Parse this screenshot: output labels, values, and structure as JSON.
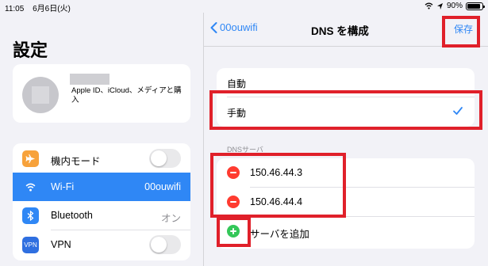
{
  "status_bar": {
    "time": "11:05",
    "date": "6月6日(火)",
    "battery": "90%",
    "battery_level": 0.9
  },
  "sidebar": {
    "title": "設定",
    "profile": {
      "subtitle": "Apple ID、iCloud、メディアと購入"
    },
    "items": [
      {
        "label": "機内モード",
        "icon": "airplane-icon",
        "icon_color": "#f7a23b",
        "toggle_on": false
      },
      {
        "label": "Wi-Fi",
        "icon": "wifi-icon",
        "icon_color": "#2f87f5",
        "value": "00ouwifi",
        "selected": true
      },
      {
        "label": "Bluetooth",
        "icon": "bluetooth-icon",
        "icon_color": "#2f87f5",
        "value": "オン"
      },
      {
        "label": "VPN",
        "icon": "vpn-icon",
        "icon_color": "#2f6fe0",
        "icon_text": "VPN",
        "toggle_on": false
      }
    ]
  },
  "detail": {
    "back_label": "00ouwifi",
    "title": "DNS を構成",
    "save_label": "保存",
    "mode_options": [
      {
        "label": "自動",
        "checked": false
      },
      {
        "label": "手動",
        "checked": true
      }
    ],
    "servers_header": "DNSサーバ",
    "servers": [
      "150.46.44.3",
      "150.46.44.4"
    ],
    "add_server_label": "サーバを追加"
  },
  "colors": {
    "accent": "#2f87f5",
    "highlight": "#e0202a",
    "remove": "#ff3b30",
    "add": "#34c759"
  }
}
